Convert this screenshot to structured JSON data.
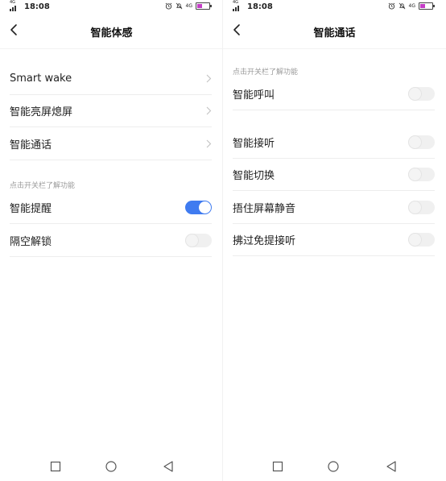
{
  "status_bar": {
    "time": "18:08",
    "network": "4G",
    "signal_label": "4G"
  },
  "left_screen": {
    "title": "智能体感",
    "menu_items": [
      {
        "label": "Smart wake"
      },
      {
        "label": "智能亮屏熄屏"
      },
      {
        "label": "智能通话"
      }
    ],
    "section_hint": "点击开关栏了解功能",
    "toggle_items": [
      {
        "label": "智能提醒",
        "on": true
      },
      {
        "label": "隔空解锁",
        "on": false
      }
    ]
  },
  "right_screen": {
    "title": "智能通话",
    "section_hint": "点击开关栏了解功能",
    "toggle_items": [
      {
        "label": "智能呼叫",
        "on": false
      },
      {
        "label": "智能接听",
        "on": false
      },
      {
        "label": "智能切换",
        "on": false
      },
      {
        "label": "捂住屏幕静音",
        "on": false
      },
      {
        "label": "拂过免提接听",
        "on": false
      }
    ]
  },
  "colors": {
    "accent": "#3f7bf0",
    "battery": "#c43dc6"
  },
  "nav_icons": [
    "recent-apps-icon",
    "home-icon",
    "back-icon"
  ]
}
